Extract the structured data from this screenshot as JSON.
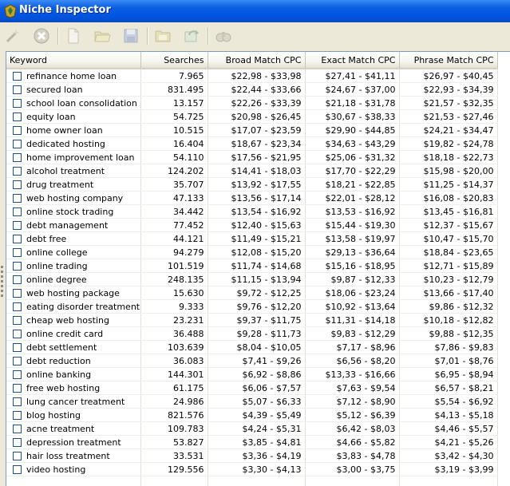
{
  "window": {
    "title": "Niche Inspector"
  },
  "toolbar": {
    "buttons": [
      {
        "name": "wand-icon"
      },
      {
        "name": "delete-icon"
      },
      {
        "name": "new-document-icon"
      },
      {
        "name": "open-folder-icon"
      },
      {
        "name": "save-icon"
      },
      {
        "name": "folder-icon"
      },
      {
        "name": "refresh-image-icon"
      },
      {
        "name": "binoculars-icon"
      }
    ]
  },
  "table": {
    "columns": [
      "Keyword",
      "Searches",
      "Broad Match CPC",
      "Exact Match CPC",
      "Phrase Match CPC"
    ],
    "rows": [
      {
        "keyword": "refinance home loan",
        "searches": "7.965",
        "broad": "$22,98 - $33,98",
        "exact": "$27,41 - $41,11",
        "phrase": "$26,97 - $40,45"
      },
      {
        "keyword": "secured loan",
        "searches": "831.495",
        "broad": "$22,44 - $33,66",
        "exact": "$24,67 - $37,00",
        "phrase": "$22,93 - $34,39"
      },
      {
        "keyword": "school loan consolidation",
        "searches": "13.157",
        "broad": "$22,26 - $33,39",
        "exact": "$21,18 - $31,78",
        "phrase": "$21,57 - $32,35"
      },
      {
        "keyword": "equity loan",
        "searches": "54.725",
        "broad": "$20,98 - $26,45",
        "exact": "$30,67 - $38,33",
        "phrase": "$21,53 - $27,46"
      },
      {
        "keyword": "home owner loan",
        "searches": "10.515",
        "broad": "$17,07 - $23,59",
        "exact": "$29,90 - $44,85",
        "phrase": "$24,21 - $34,47"
      },
      {
        "keyword": "dedicated hosting",
        "searches": "16.404",
        "broad": "$18,67 - $23,34",
        "exact": "$34,63 - $43,29",
        "phrase": "$19,82 - $24,78"
      },
      {
        "keyword": "home improvement loan",
        "searches": "54.110",
        "broad": "$17,56 - $21,95",
        "exact": "$25,06 - $31,32",
        "phrase": "$18,18 - $22,73"
      },
      {
        "keyword": "alcohol treatment",
        "searches": "124.202",
        "broad": "$14,41 - $18,03",
        "exact": "$17,70 - $22,29",
        "phrase": "$15,98 - $20,00"
      },
      {
        "keyword": "drug treatment",
        "searches": "35.707",
        "broad": "$13,92 - $17,55",
        "exact": "$18,21 - $22,85",
        "phrase": "$11,25 - $14,37"
      },
      {
        "keyword": "web hosting company",
        "searches": "47.133",
        "broad": "$13,56 - $17,14",
        "exact": "$22,01 - $28,12",
        "phrase": "$16,08 - $20,83"
      },
      {
        "keyword": "online stock trading",
        "searches": "34.442",
        "broad": "$13,54 - $16,92",
        "exact": "$13,53 - $16,92",
        "phrase": "$13,45 - $16,81"
      },
      {
        "keyword": "debt management",
        "searches": "77.452",
        "broad": "$12,40 - $15,63",
        "exact": "$15,44 - $19,30",
        "phrase": "$12,37 - $15,67"
      },
      {
        "keyword": "debt free",
        "searches": "44.121",
        "broad": "$11,49 - $15,21",
        "exact": "$13,58 - $19,97",
        "phrase": "$10,47 - $15,70"
      },
      {
        "keyword": "online college",
        "searches": "94.279",
        "broad": "$12,08 - $15,20",
        "exact": "$29,13 - $36,64",
        "phrase": "$18,84 - $23,65"
      },
      {
        "keyword": "online trading",
        "searches": "101.519",
        "broad": "$11,74 - $14,68",
        "exact": "$15,16 - $18,95",
        "phrase": "$12,71 - $15,89"
      },
      {
        "keyword": "online degree",
        "searches": "248.135",
        "broad": "$11,15 - $13,94",
        "exact": "$9,87 - $12,33",
        "phrase": "$10,23 - $12,79"
      },
      {
        "keyword": "web hosting package",
        "searches": "15.630",
        "broad": "$9,72 - $12,25",
        "exact": "$18,06 - $23,24",
        "phrase": "$13,66 - $17,40"
      },
      {
        "keyword": "eating disorder treatment",
        "searches": "9.333",
        "broad": "$9,76 - $12,20",
        "exact": "$10,92 - $13,64",
        "phrase": "$9,86 - $12,32"
      },
      {
        "keyword": "cheap web hosting",
        "searches": "23.231",
        "broad": "$9,37 - $11,75",
        "exact": "$11,31 - $14,18",
        "phrase": "$10,18 - $12,82"
      },
      {
        "keyword": "online credit card",
        "searches": "36.488",
        "broad": "$9,28 - $11,73",
        "exact": "$9,83 - $12,29",
        "phrase": "$9,88 - $12,35"
      },
      {
        "keyword": "debt settlement",
        "searches": "103.639",
        "broad": "$8,04 - $10,05",
        "exact": "$7,17 - $8,96",
        "phrase": "$7,86 - $9,83"
      },
      {
        "keyword": "debt reduction",
        "searches": "36.083",
        "broad": "$7,41 - $9,26",
        "exact": "$6,56 - $8,20",
        "phrase": "$7,01 - $8,76"
      },
      {
        "keyword": "online banking",
        "searches": "144.301",
        "broad": "$6,92 - $8,86",
        "exact": "$13,33 - $16,66",
        "phrase": "$6,95 - $8,94"
      },
      {
        "keyword": "free web hosting",
        "searches": "61.175",
        "broad": "$6,06 - $7,57",
        "exact": "$7,63 - $9,54",
        "phrase": "$6,57 - $8,21"
      },
      {
        "keyword": "lung cancer treatment",
        "searches": "24.986",
        "broad": "$5,07 - $6,33",
        "exact": "$7,12 - $8,90",
        "phrase": "$5,54 - $6,92"
      },
      {
        "keyword": "blog hosting",
        "searches": "821.576",
        "broad": "$4,39 - $5,49",
        "exact": "$5,12 - $6,39",
        "phrase": "$4,13 - $5,18"
      },
      {
        "keyword": "acne treatment",
        "searches": "109.783",
        "broad": "$4,24 - $5,31",
        "exact": "$6,42 - $8,03",
        "phrase": "$4,46 - $5,57"
      },
      {
        "keyword": "depression treatment",
        "searches": "53.827",
        "broad": "$3,85 - $4,81",
        "exact": "$4,66 - $5,82",
        "phrase": "$4,21 - $5,26"
      },
      {
        "keyword": "hair loss treatment",
        "searches": "33.531",
        "broad": "$3,36 - $4,19",
        "exact": "$3,83 - $4,78",
        "phrase": "$3,42 - $4,30"
      },
      {
        "keyword": "video hosting",
        "searches": "129.556",
        "broad": "$3,30 - $4,13",
        "exact": "$3,00 - $3,75",
        "phrase": "$3,19 - $3,99"
      }
    ]
  }
}
